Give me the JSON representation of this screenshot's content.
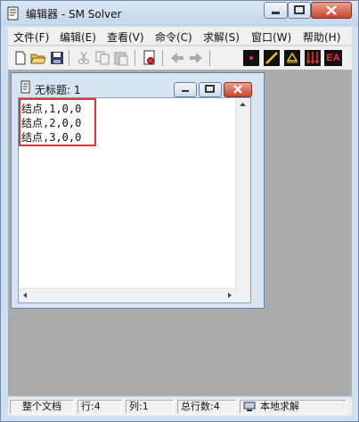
{
  "window": {
    "title": "编辑器 - SM Solver"
  },
  "menu": {
    "items": [
      "文件(F)",
      "编辑(E)",
      "查看(V)",
      "命令(C)",
      "求解(S)",
      "窗口(W)",
      "帮助(H)"
    ]
  },
  "toolbar": {
    "icons": [
      "new-document-icon",
      "open-folder-icon",
      "save-icon",
      "cut-icon",
      "copy-icon",
      "paste-icon",
      "settings-document-icon",
      "arrow-left-icon",
      "arrow-right-icon",
      "node-icon",
      "element-icon",
      "support-icon",
      "load-icon"
    ],
    "ea_label": "EA"
  },
  "document": {
    "title": "无标题: 1",
    "lines": [
      "结点,1,0,0",
      "结点,2,0,0",
      "结点,3,0,0"
    ]
  },
  "status": {
    "scope": "整个文档",
    "row": "行:4",
    "col": "列:1",
    "total": "总行数:4",
    "solver": "本地求解"
  },
  "colors": {
    "highlight_box": "#d93737",
    "close_button": "#c8462e"
  }
}
